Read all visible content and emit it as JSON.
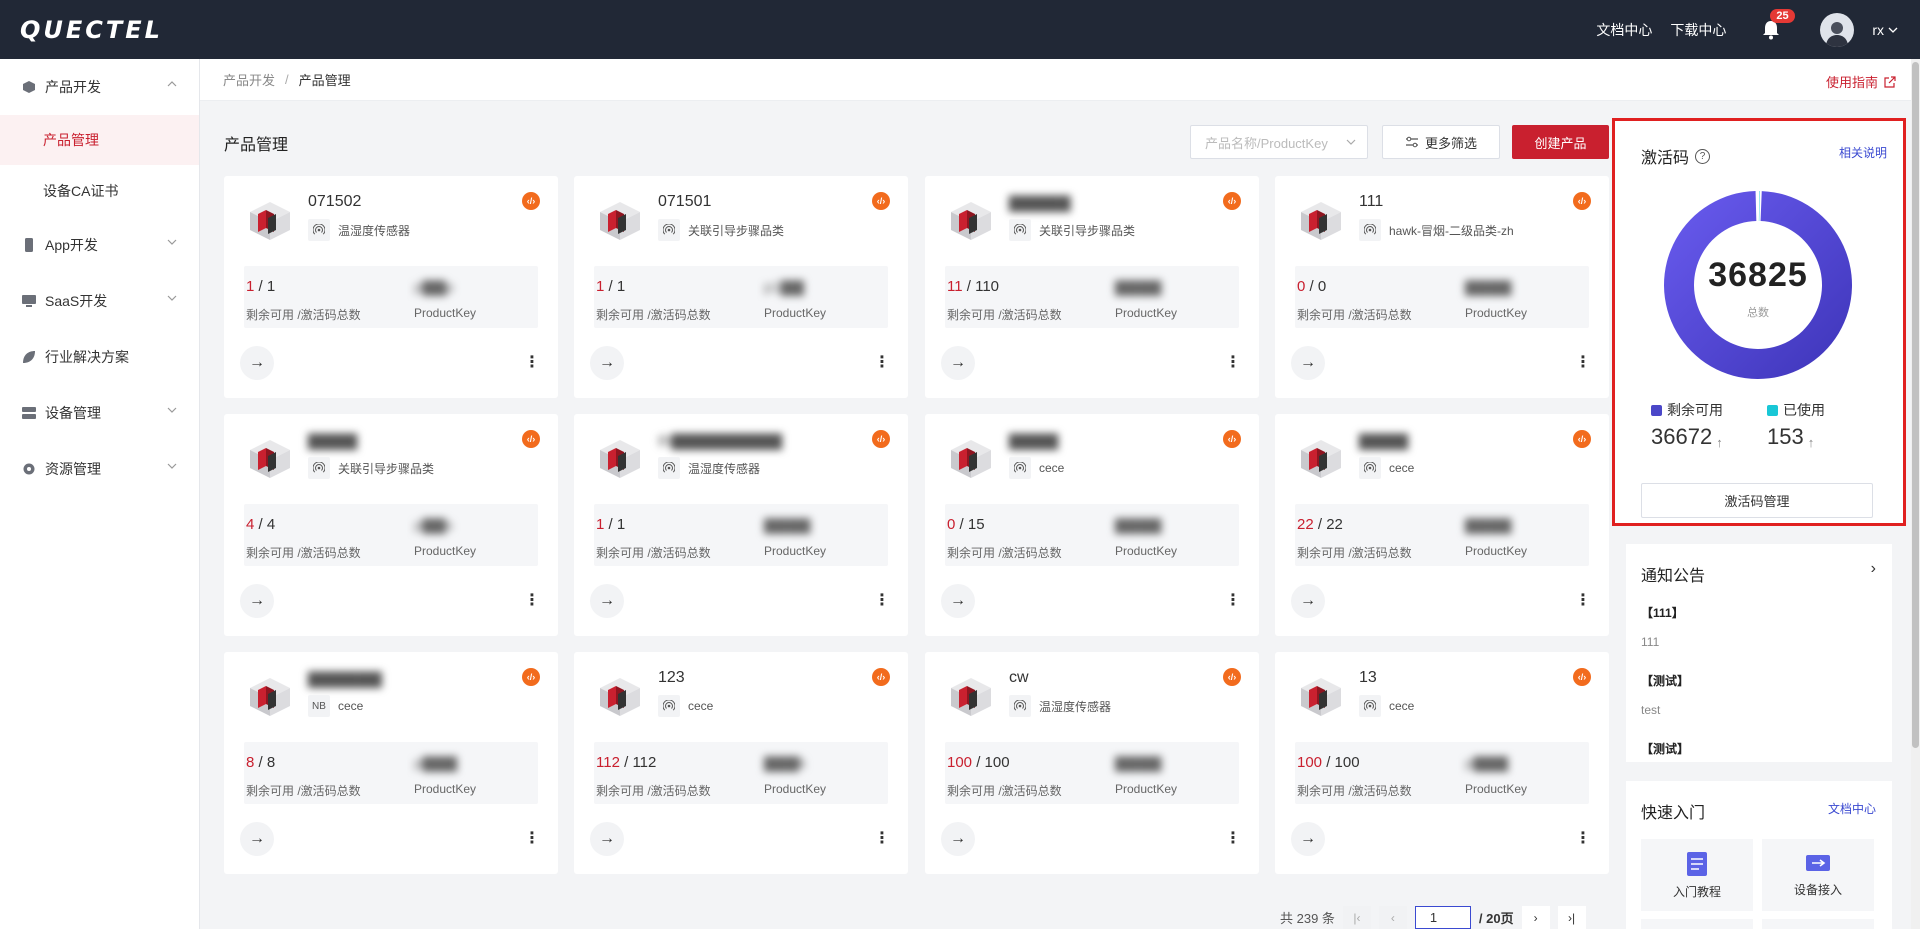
{
  "topbar": {
    "logo": "QUECTEL",
    "doc_center": "文档中心",
    "download_center": "下载中心",
    "notification_count": "25",
    "username": "rx"
  },
  "sidebar": {
    "items": [
      {
        "label": "产品开发",
        "icon": "cube-icon",
        "expanded": true
      },
      {
        "label": "产品管理",
        "active": true
      },
      {
        "label": "设备CA证书"
      },
      {
        "label": "App开发",
        "icon": "phone-icon"
      },
      {
        "label": "SaaS开发",
        "icon": "monitor-icon"
      },
      {
        "label": "行业解决方案",
        "icon": "leaf-icon"
      },
      {
        "label": "设备管理",
        "icon": "server-icon"
      },
      {
        "label": "资源管理",
        "icon": "gear-icon"
      }
    ]
  },
  "breadcrumb": {
    "parent": "产品开发",
    "separator": "/",
    "current": "产品管理",
    "guide": "使用指南"
  },
  "main": {
    "title": "产品管理",
    "search_placeholder": "产品名称/ProductKey",
    "filter_label": "更多筛选",
    "create_label": "创建产品"
  },
  "card_labels": {
    "count_label": "剩余可用 /激活码总数",
    "pk_label": "ProductKey",
    "arrow": "→",
    "more": "⋮",
    "code_badge": "‹/›"
  },
  "cards": [
    {
      "name": "071502",
      "name_blurred": false,
      "tag": "温湿度传感器",
      "tag_icon": "wireless-icon",
      "available": "1",
      "total": "1",
      "pk": "p▇▇p"
    },
    {
      "name": "071501",
      "name_blurred": false,
      "tag": "关联引导步骤品类",
      "tag_icon": "wireless-icon",
      "available": "1",
      "total": "1",
      "pk": "p1▇▇"
    },
    {
      "name": "▇▇▇▇▇",
      "name_blurred": true,
      "tag": "关联引导步骤品类",
      "tag_icon": "wireless-icon",
      "available": "11",
      "total": "110",
      "pk": "▇▇▇▇"
    },
    {
      "name": "111",
      "name_blurred": false,
      "tag": "hawk-冒烟-二级品类-zh",
      "tag_icon": "wireless-icon",
      "available": "0",
      "total": "0",
      "pk": "▇▇▇▇"
    },
    {
      "name": "▇▇▇▇",
      "name_blurred": true,
      "tag": "关联引导步骤品类",
      "tag_icon": "wireless-icon",
      "available": "4",
      "total": "4",
      "pk": "p▇▇s"
    },
    {
      "name": "th▇▇▇▇▇▇▇▇▇",
      "name_blurred": true,
      "tag": "温湿度传感器",
      "tag_icon": "wireless-icon",
      "available": "1",
      "total": "1",
      "pk": "▇▇▇▇"
    },
    {
      "name": "▇▇▇▇",
      "name_blurred": true,
      "tag": "cece",
      "tag_icon": "wireless-icon",
      "available": "0",
      "total": "15",
      "pk": "▇▇▇▇"
    },
    {
      "name": "▇▇▇▇",
      "name_blurred": true,
      "tag": "cece",
      "tag_icon": "wireless-icon",
      "available": "22",
      "total": "22",
      "pk": "▇▇▇▇"
    },
    {
      "name": "▇▇▇▇▇▇",
      "name_blurred": true,
      "tag": "cece",
      "tag_icon": "nb-icon",
      "tag_icon_text": "NB",
      "available": "8",
      "total": "8",
      "pk": "p▇▇▇"
    },
    {
      "name": "123",
      "name_blurred": false,
      "tag": "cece",
      "tag_icon": "wireless-icon",
      "available": "112",
      "total": "112",
      "pk": "▇▇▇k"
    },
    {
      "name": "cw",
      "name_blurred": false,
      "tag": "温湿度传感器",
      "tag_icon": "wireless-icon",
      "available": "100",
      "total": "100",
      "pk": "▇▇▇▇"
    },
    {
      "name": "13",
      "name_blurred": false,
      "tag": "cece",
      "tag_icon": "wireless-icon",
      "available": "100",
      "total": "100",
      "pk": "p▇▇▇"
    }
  ],
  "pagination": {
    "total_text": "共 239 条",
    "current_page": "1",
    "total_pages": "/ 20页"
  },
  "activation": {
    "title": "激活码",
    "help_link": "相关说明",
    "total": "36825",
    "total_label": "总数",
    "remaining_label": "剩余可用",
    "remaining_value": "36672",
    "used_label": "已使用",
    "used_value": "153",
    "manage_label": "激活码管理",
    "remaining_color": "#4b47c8",
    "used_color": "#19c7d6"
  },
  "chart_data": {
    "type": "pie",
    "categories": [
      "剩余可用",
      "已使用"
    ],
    "values": [
      36672,
      153
    ],
    "title": "激活码"
  },
  "notice": {
    "title": "通知公告",
    "items": [
      {
        "title": "【111】",
        "body": "111"
      },
      {
        "title": "【测试】",
        "body": "test"
      },
      {
        "title": "【测试】",
        "body": ""
      }
    ]
  },
  "quick": {
    "title": "快速入门",
    "link": "文档中心",
    "tiles": [
      {
        "label": "入门教程",
        "icon": "document-icon"
      },
      {
        "label": "设备接入",
        "icon": "device-icon"
      }
    ]
  },
  "colors": {
    "brand_red": "#c9202f",
    "accent_blue": "#3b4ad1",
    "badge_orange": "#f26b1d"
  }
}
